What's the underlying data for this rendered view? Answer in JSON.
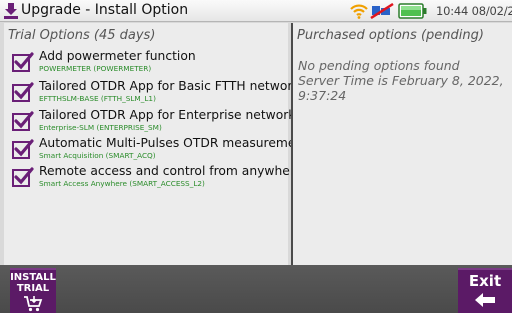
{
  "header": {
    "title": "Upgrade - Install Option",
    "clock": "10:44 08/02/2022",
    "icons": [
      "download-icon",
      "wifi-icon",
      "ethernet-icon",
      "battery-icon"
    ]
  },
  "trial": {
    "title": "Trial Options (45 days)",
    "options": [
      {
        "label": "Add powermeter function",
        "code": "POWERMETER (POWERMETER)",
        "checked": true
      },
      {
        "label": "Tailored OTDR App for Basic FTTH networks",
        "code": "EFTTHSLM-BASE (FTTH_SLM_L1)",
        "checked": true
      },
      {
        "label": "Tailored OTDR App for Enterprise networks",
        "code": "Enterprise-SLM (ENTERPRISE_SM)",
        "checked": true
      },
      {
        "label": "Automatic Multi-Pulses OTDR measurement",
        "code": "Smart Acquisition (SMART_ACQ)",
        "checked": true
      },
      {
        "label": "Remote access and control from anywhere",
        "code": "Smart Access Anywhere (SMART_ACCESS_L2)",
        "checked": true
      }
    ]
  },
  "purchased": {
    "title": "Purchased options (pending)",
    "lines": [
      "No pending options found",
      "Server Time is February 8, 2022,",
      "9:37:24"
    ]
  },
  "footer": {
    "install_label": "INSTALL\nTRIAL",
    "exit_label": "Exit"
  },
  "colors": {
    "accent": "#5b1a66",
    "check": "#6a1f77",
    "code_green": "#2a8c2a"
  }
}
